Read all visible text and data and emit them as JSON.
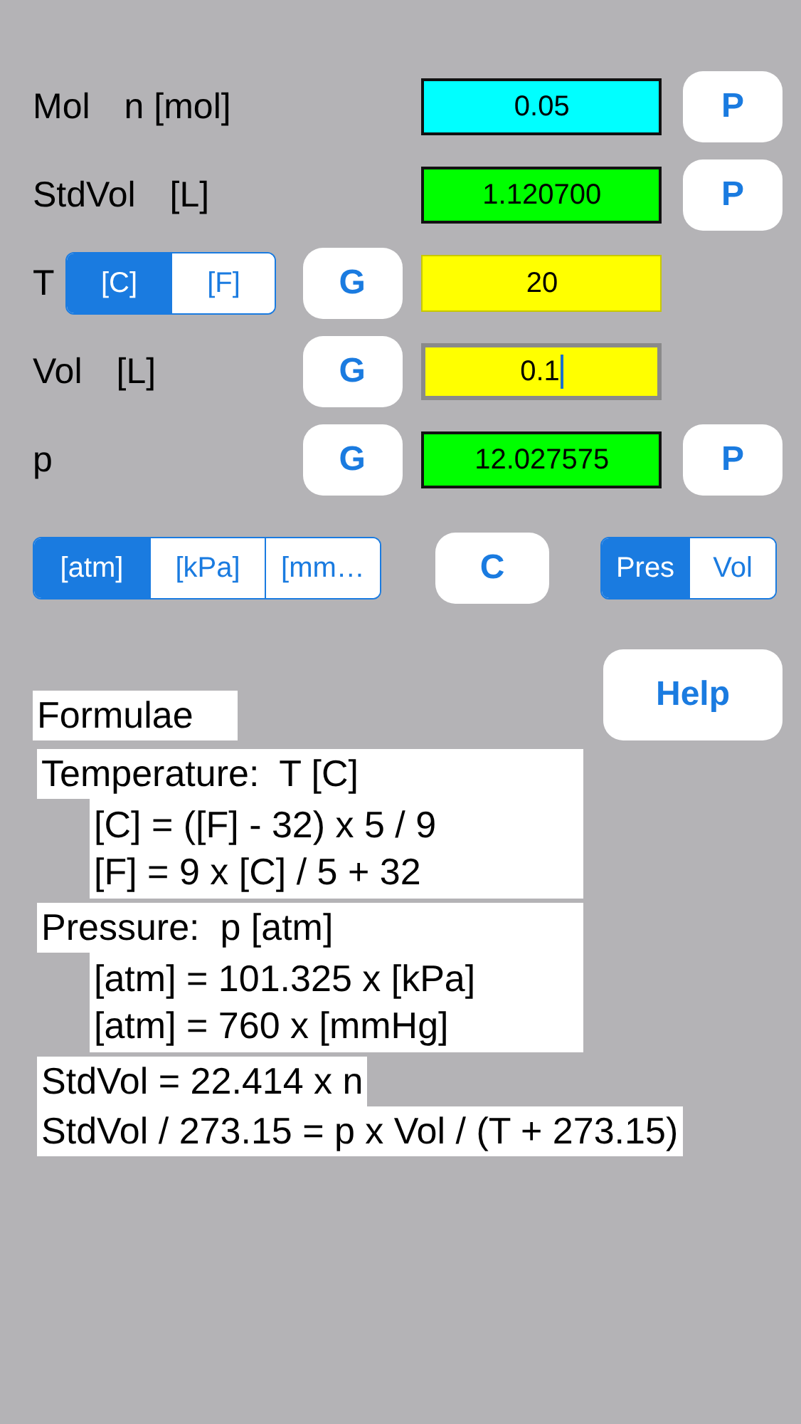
{
  "rows": [
    {
      "label": "Mol",
      "unit": "n [mol]",
      "g_button": null,
      "field": {
        "value": "0.05",
        "color": "#00ffff",
        "focused": false
      },
      "p_button": "P"
    },
    {
      "label": "StdVol",
      "unit": "[L]",
      "g_button": null,
      "field": {
        "value": "1.120700",
        "color": "#00ff00",
        "focused": false
      },
      "p_button": "P"
    },
    {
      "label": "T",
      "temp_units": [
        {
          "label": "[C]",
          "selected": true
        },
        {
          "label": "[F]",
          "selected": false
        }
      ],
      "g_button": "G",
      "field": {
        "value": "20",
        "color": "#ffff00",
        "focused": false
      },
      "p_button": null
    },
    {
      "label": "Vol",
      "unit": "[L]",
      "g_button": "G",
      "field": {
        "value": "0.1",
        "color": "#ffff00",
        "focused": true
      },
      "p_button": null
    },
    {
      "label": "p",
      "unit": null,
      "g_button": "G",
      "field": {
        "value": "12.027575",
        "color": "#00ff00",
        "focused": false
      },
      "p_button": "P"
    }
  ],
  "pressure_units": [
    {
      "label": "[atm]",
      "selected": true
    },
    {
      "label": "[kPa]",
      "selected": false
    },
    {
      "label": "[mm…",
      "selected": false
    }
  ],
  "clear_button": "C",
  "mode": [
    {
      "label": "Pres",
      "selected": true
    },
    {
      "label": "Vol",
      "selected": false
    }
  ],
  "help_button": "Help",
  "formulae": {
    "title": "Formulae",
    "sections": [
      {
        "heading": "Temperature:  T [C]",
        "lines": [
          "[C] = ([F] - 32) x 5 / 9",
          "[F] = 9 x [C] / 5 + 32"
        ]
      },
      {
        "heading": "Pressure:  p [atm]",
        "lines": [
          "[atm] = 101.325 x [kPa]",
          "[atm] = 760 x [mmHg]"
        ]
      }
    ],
    "equations": [
      "StdVol = 22.414 x n",
      "StdVol / 273.15 = p x Vol / (T + 273.15)"
    ]
  }
}
